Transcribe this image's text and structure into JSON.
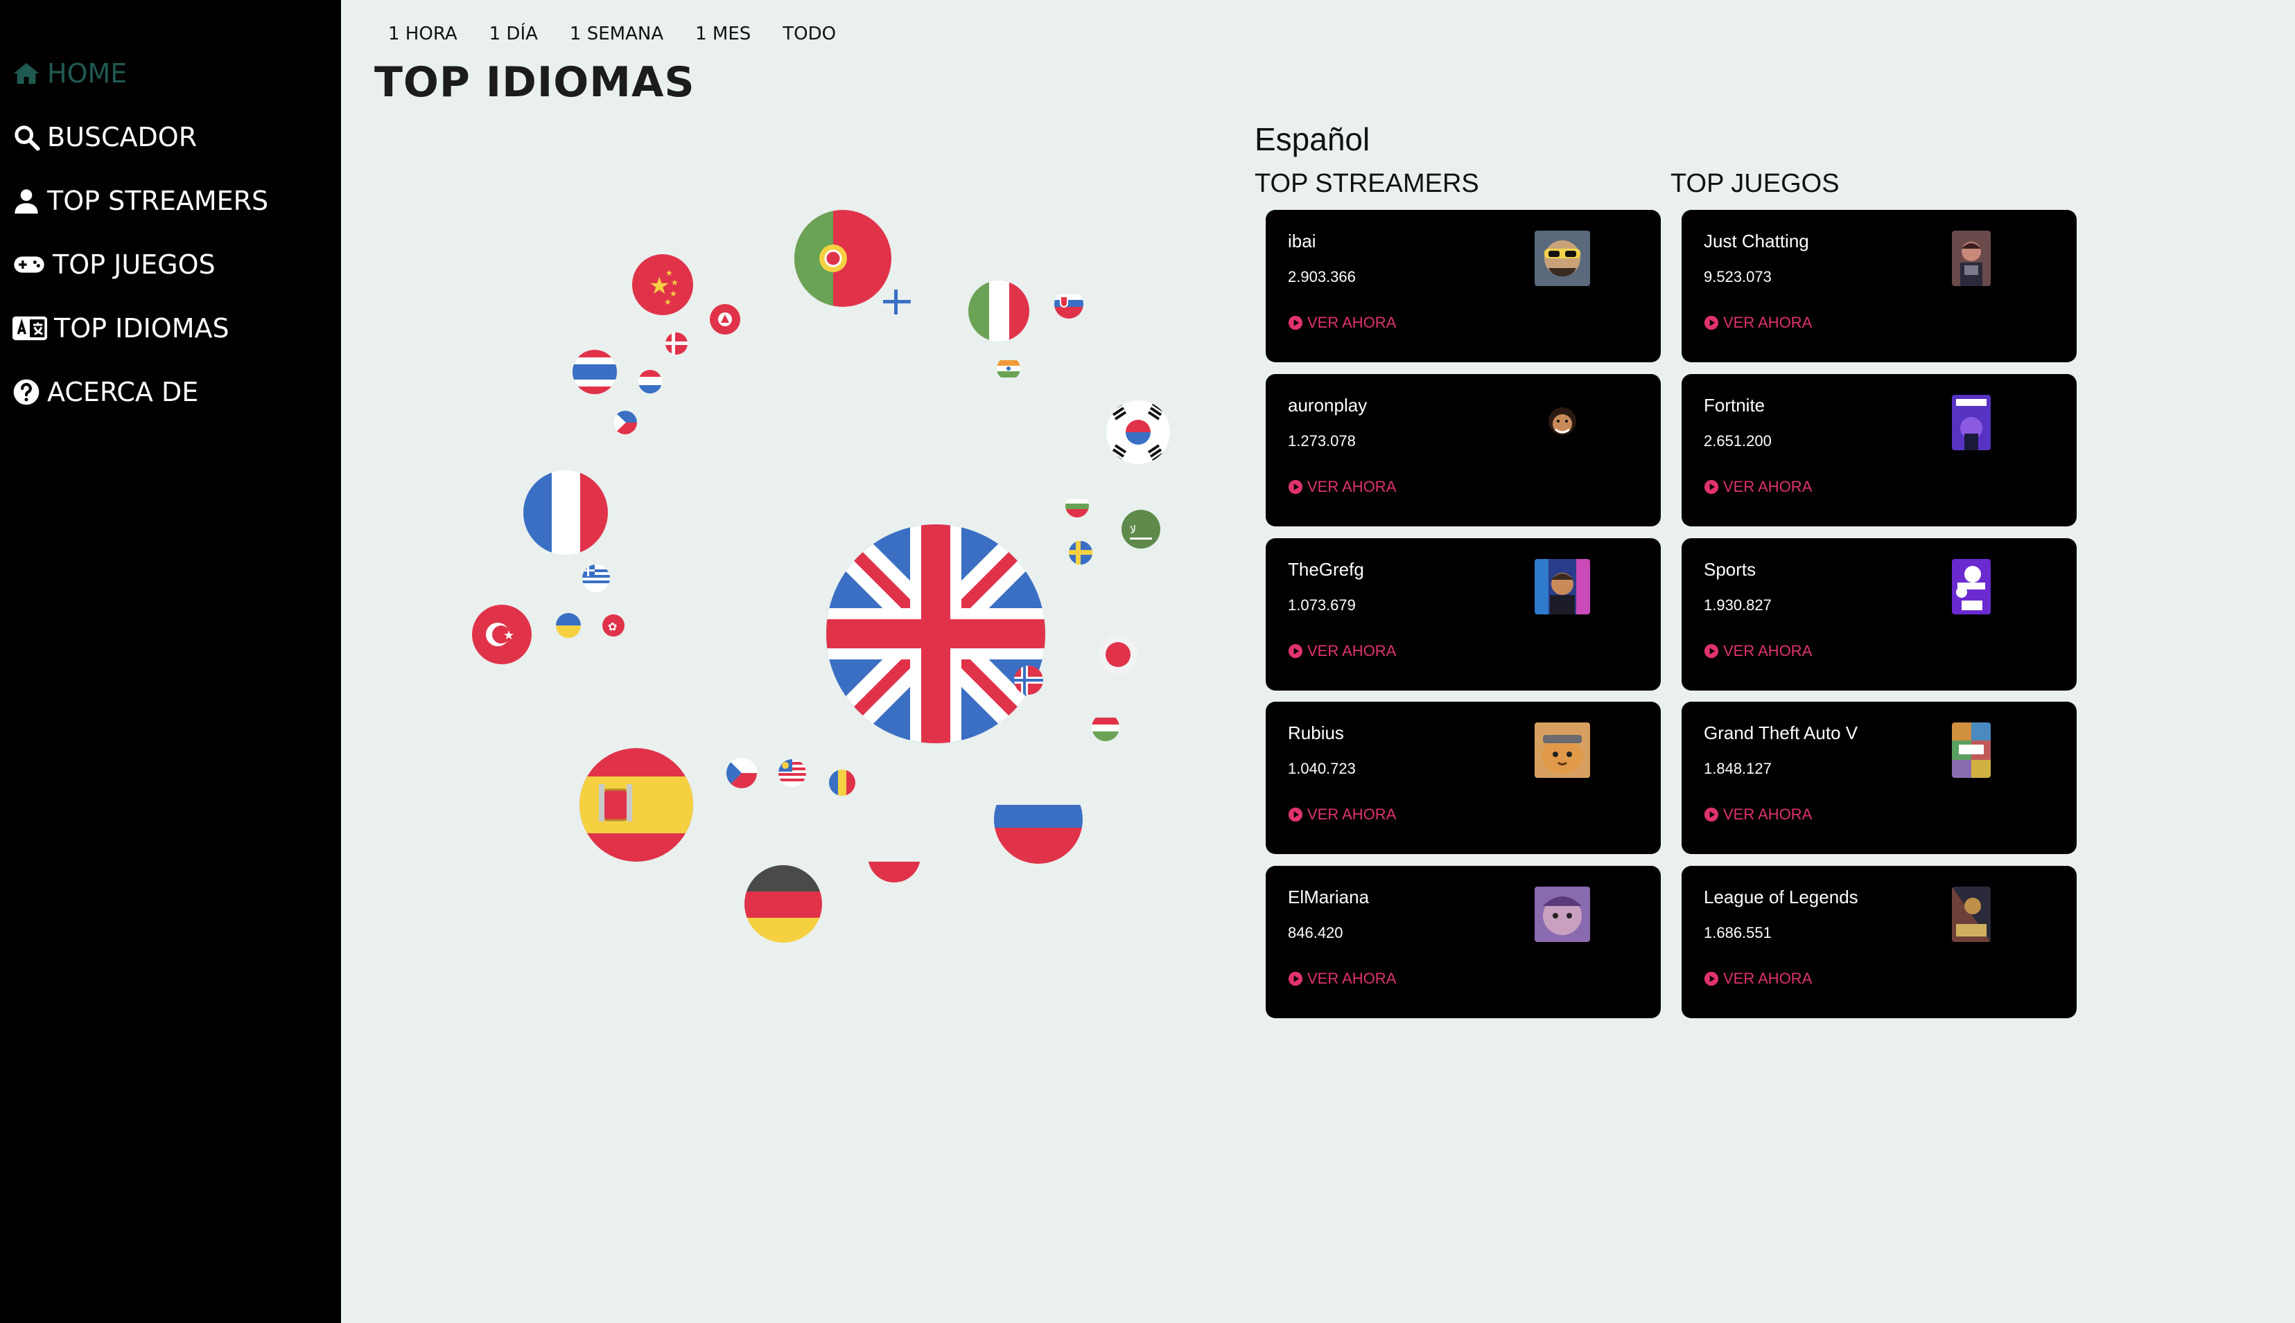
{
  "sidebar": {
    "items": [
      {
        "label": "HOME",
        "icon": "home-icon",
        "active": true
      },
      {
        "label": "BUSCADOR",
        "icon": "search-icon",
        "active": false
      },
      {
        "label": "TOP STREAMERS",
        "icon": "user-icon",
        "active": false
      },
      {
        "label": "TOP JUEGOS",
        "icon": "gamepad-icon",
        "active": false
      },
      {
        "label": "TOP IDIOMAS",
        "icon": "language-icon",
        "active": false
      },
      {
        "label": "ACERCA DE",
        "icon": "question-circle-icon",
        "active": false
      }
    ]
  },
  "filters": [
    "1 HORA",
    "1 DÍA",
    "1 SEMANA",
    "1 MES",
    "TODO"
  ],
  "page": {
    "title": "TOP IDIOMAS"
  },
  "selected_language": "Español",
  "streamers": {
    "title": "TOP STREAMERS",
    "items": [
      {
        "name": "ibai",
        "count": "2.903.366",
        "action": "VER AHORA"
      },
      {
        "name": "auronplay",
        "count": "1.273.078",
        "action": "VER AHORA"
      },
      {
        "name": "TheGrefg",
        "count": "1.073.679",
        "action": "VER AHORA"
      },
      {
        "name": "Rubius",
        "count": "1.040.723",
        "action": "VER AHORA"
      },
      {
        "name": "ElMariana",
        "count": "846.420",
        "action": "VER AHORA"
      }
    ]
  },
  "games": {
    "title": "TOP JUEGOS",
    "items": [
      {
        "name": "Just Chatting",
        "count": "9.523.073",
        "action": "VER AHORA"
      },
      {
        "name": "Fortnite",
        "count": "2.651.200",
        "action": "VER AHORA"
      },
      {
        "name": "Sports",
        "count": "1.930.827",
        "action": "VER AHORA"
      },
      {
        "name": "Grand Theft Auto V",
        "count": "1.848.127",
        "action": "VER AHORA"
      },
      {
        "name": "League of Legends",
        "count": "1.686.551",
        "action": "VER AHORA"
      }
    ]
  },
  "colors": {
    "accent": "#e0336e",
    "active_nav": "#1f5a52",
    "background": "#e9f0ee"
  },
  "bubble_flags": [
    "english-flag",
    "spanish-flag",
    "portuguese-flag",
    "french-flag",
    "german-flag",
    "russian-flag",
    "italian-flag",
    "korean-flag",
    "chinese-flag",
    "turkish-flag",
    "thai-flag",
    "polish-flag",
    "japanese-flag",
    "arabic-flag",
    "hungarian-flag",
    "swedish-flag",
    "czech-flag",
    "romanian-flag",
    "malay-flag",
    "norwegian-flag",
    "danish-flag",
    "dutch-flag",
    "greek-flag",
    "ukrainian-flag",
    "hongkong-flag",
    "vietnamese-flag",
    "filipino-flag",
    "bulgarian-flag",
    "slovak-flag",
    "indian-flag",
    "finnish-flag"
  ]
}
